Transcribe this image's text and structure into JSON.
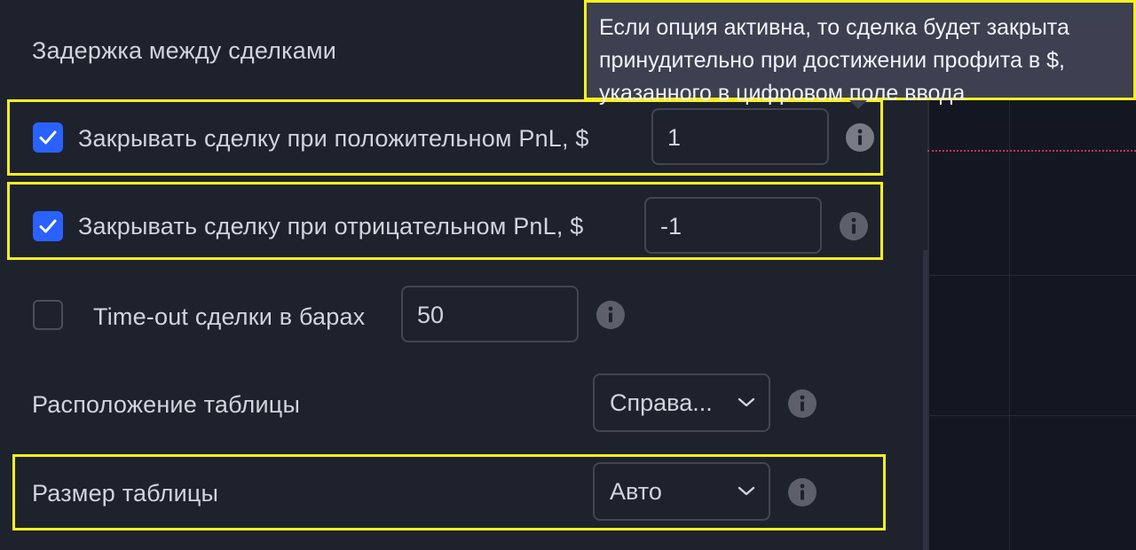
{
  "rows": {
    "delay": {
      "label": "Задержка между сделками"
    },
    "positive_pnl": {
      "label": "Закрывать сделку при положительном PnL, $",
      "checked": true,
      "value": "1"
    },
    "negative_pnl": {
      "label": "Закрывать сделку при отрицательном PnL, $",
      "checked": true,
      "value": "-1"
    },
    "timeout": {
      "label": "Time-out сделки в барах",
      "checked": false,
      "value": "50"
    },
    "table_position": {
      "label": "Расположение таблицы",
      "selected": "Справа..."
    },
    "table_size": {
      "label": "Размер таблицы",
      "selected": "Авто"
    }
  },
  "tooltip": {
    "text": "Если опция активна, то сделка будет закрыта принудительно при достижении профита в $, указанного в цифровом поле ввода"
  },
  "icons": {
    "info": "info-icon",
    "check": "checkmark-icon",
    "chevron": "chevron-down-icon"
  },
  "colors": {
    "background": "#1e222d",
    "chart_background": "#131722",
    "accent": "#2962ff",
    "highlight": "#fbf01e",
    "tooltip_background": "#3d4050",
    "price_line": "#c4344d"
  }
}
